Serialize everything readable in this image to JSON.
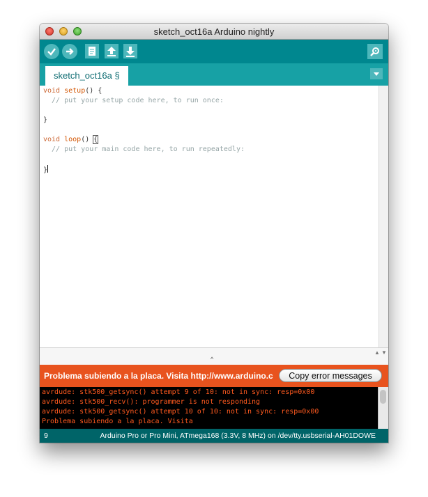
{
  "window": {
    "title": "sketch_oct16a Arduino nightly"
  },
  "toolbar": {
    "buttons": [
      "verify-icon",
      "upload-icon",
      "new-icon",
      "open-icon",
      "save-icon",
      "serial-monitor-icon"
    ]
  },
  "tabs": {
    "active": "sketch_oct16a §"
  },
  "editor": {
    "lines": [
      {
        "kw": "void",
        "fn": "setup",
        "rest": "() {"
      },
      {
        "comment": "  // put your setup code here, to run once:"
      },
      {
        "text": ""
      },
      {
        "text": "}"
      },
      {
        "text": ""
      },
      {
        "kw": "void",
        "fn": "loop",
        "rest": "() ",
        "brace": "{"
      },
      {
        "comment": "  // put your main code here, to run repeatedly:"
      },
      {
        "text": ""
      },
      {
        "text": "}"
      }
    ]
  },
  "error_bar": {
    "message": "Problema subiendo a la placa. Visita http://www.arduino.c",
    "copy_button": "Copy error messages"
  },
  "console": {
    "lines": [
      "avrdude: stk500_getsync() attempt 9 of 10: not in sync: resp=0x00",
      "avrdude: stk500_recv(): programmer is not responding",
      "avrdude: stk500_getsync() attempt 10 of 10: not in sync: resp=0x00",
      "Problema subiendo a la placa. Visita"
    ]
  },
  "status": {
    "line": "9",
    "board": "Arduino Pro or Pro Mini, ATmega168 (3.3V, 8 MHz) on /dev/tty.usbserial-AH01DOWE"
  },
  "colors": {
    "toolbar": "#00878f",
    "tabs": "#17a1a5",
    "error": "#e8531e",
    "status": "#006468"
  }
}
